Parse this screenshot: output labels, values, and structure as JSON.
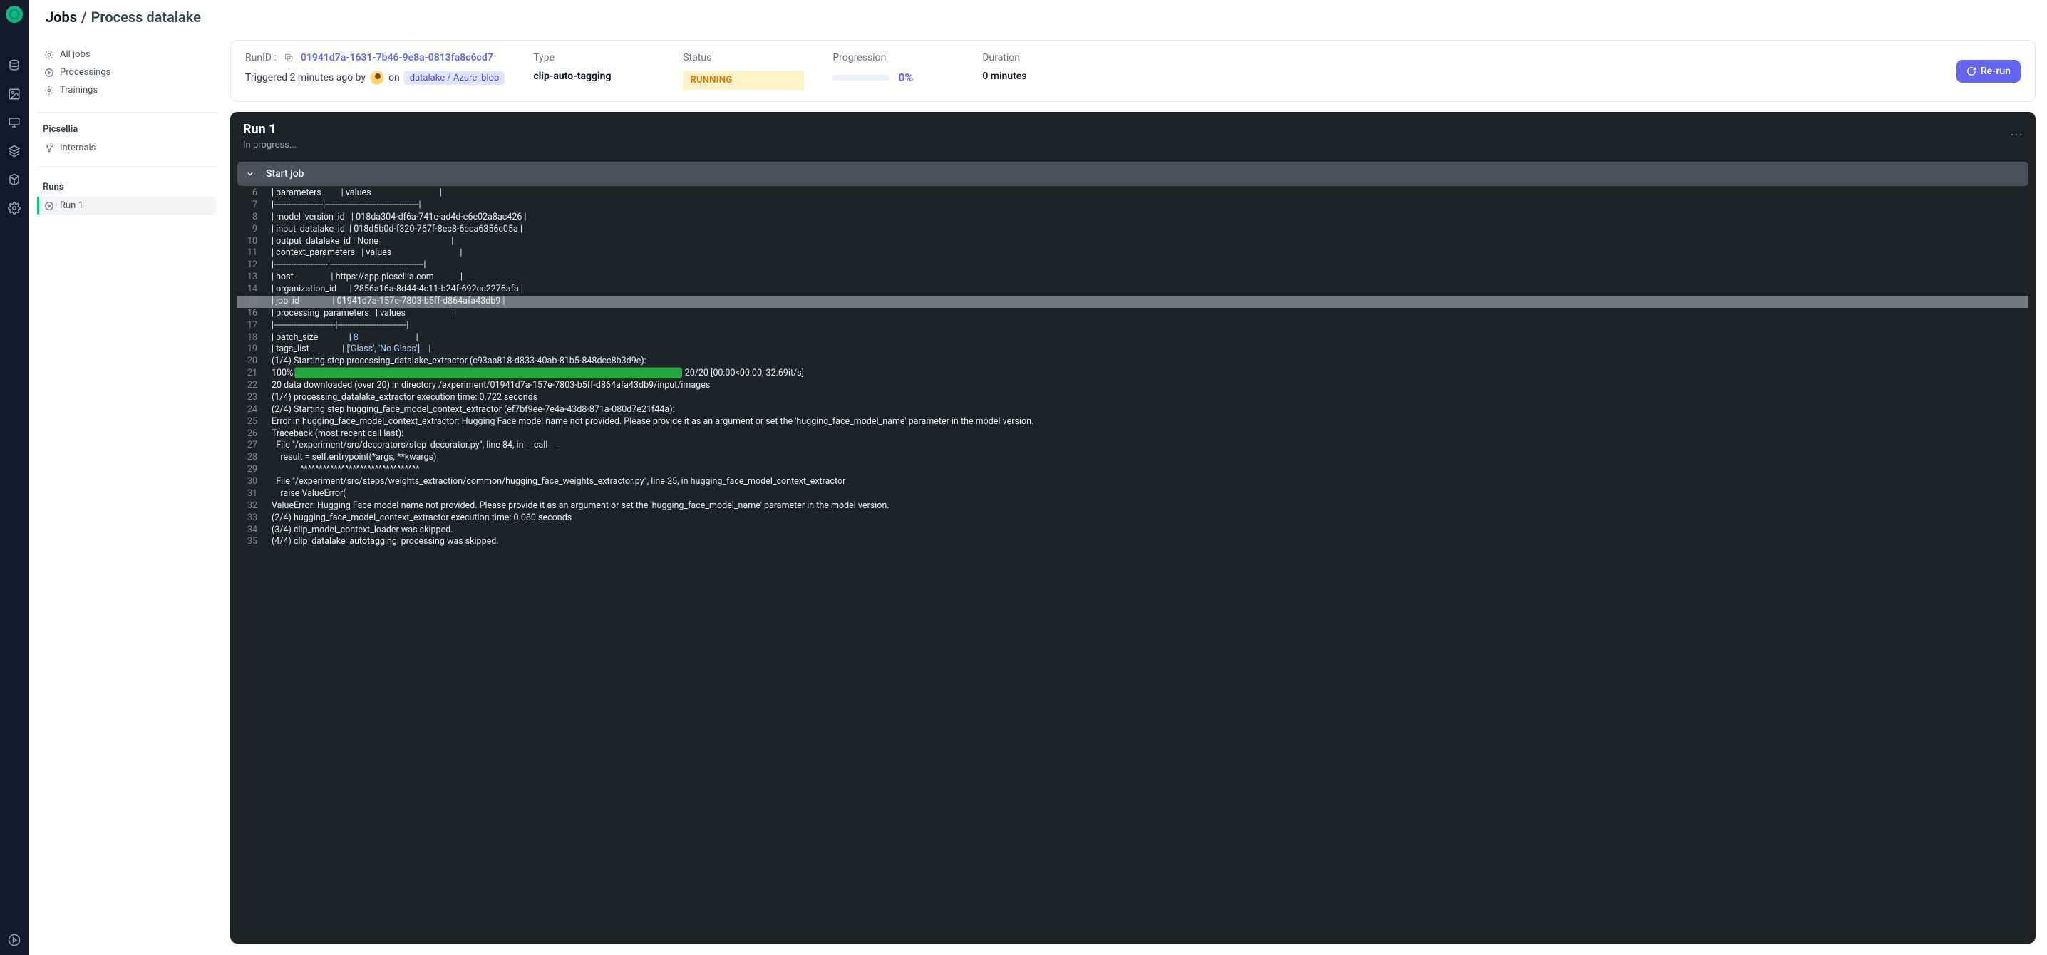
{
  "breadcrumb": {
    "root": "Jobs",
    "sep": "/",
    "page": "Process datalake"
  },
  "sidebar": {
    "groups": [
      {
        "items": [
          {
            "label": "All jobs"
          },
          {
            "label": "Processings"
          },
          {
            "label": "Trainings"
          }
        ]
      },
      {
        "title": "Picsellia",
        "items": [
          {
            "label": "Internals"
          }
        ]
      },
      {
        "title": "Runs",
        "items": [
          {
            "label": "Run 1",
            "active": true
          }
        ]
      }
    ]
  },
  "info": {
    "runid_label": "RunID :",
    "runid": "01941d7a-1631-7b46-9e8a-0813fa8c6cd7",
    "triggered_prefix": "Triggered 2 minutes ago by",
    "triggered_on": "on",
    "context": "datalake / Azure_blob",
    "type_label": "Type",
    "type_value": "clip-auto-tagging",
    "status_label": "Status",
    "status_value": "RUNNING",
    "progress_label": "Progression",
    "progress_value": "0%",
    "duration_label": "Duration",
    "duration_value": "0 minutes",
    "rerun": "Re-run"
  },
  "run": {
    "title": "Run 1",
    "subtitle": "In progress...",
    "section": "Start job"
  },
  "logs": [
    {
      "n": 6,
      "t": "| parameters         | values                               |"
    },
    {
      "n": 7,
      "t": "|--------------------|--------------------------------------|"
    },
    {
      "n": 8,
      "t": "| model_version_id   | 018da304-df6a-741e-ad4d-e6e02a8ac426 |"
    },
    {
      "n": 9,
      "t": "| input_datalake_id  | 018d5b0d-f320-767f-8ec8-6cca6356c05a |"
    },
    {
      "n": 10,
      "t": "| output_datalake_id | None                                 |"
    },
    {
      "n": 11,
      "t": "| context_parameters   | values                               |"
    },
    {
      "n": 12,
      "t": "|----------------------|--------------------------------------|"
    },
    {
      "n": 13,
      "t": "| host                 | https://app.picsellia.com            |"
    },
    {
      "n": 14,
      "t": "| organization_id      | 2856a16a-8d44-4c11-b24f-692cc2276afa |"
    },
    {
      "n": 15,
      "t": "| job_id               | 01941d7a-157e-7803-b5ff-d864afa43db9 |",
      "hl": true
    },
    {
      "n": 16,
      "t": "| processing_parameters   | values                     |"
    },
    {
      "n": 17,
      "t": "|-------------------------|----------------------------|"
    },
    {
      "n": 18,
      "t": "| batch_size              | <NUM>8</NUM>                          |"
    },
    {
      "n": 19,
      "t": "| tags_list               | <STR>['Glass', 'No Glass']</STR>    |"
    },
    {
      "n": 20,
      "t": "(1/4) Starting step processing_datalake_extractor (c93aa818-d833-40ab-81b5-848dcc8b3d9e):"
    },
    {
      "n": 21,
      "t": "100%|<BAR>█████████████████████████████████████████████████████████████</BAR>| 20/20 [00:00<00:00, 32.69it/s]"
    },
    {
      "n": 22,
      "t": "20 data downloaded (over 20) in directory /experiment/01941d7a-157e-7803-b5ff-d864afa43db9/input/images"
    },
    {
      "n": 23,
      "t": "(1/4) processing_datalake_extractor execution time: 0.722 seconds"
    },
    {
      "n": 24,
      "t": "(2/4) Starting step hugging_face_model_context_extractor (ef7bf9ee-7e4a-43d8-871a-080d7e21f44a):"
    },
    {
      "n": 25,
      "t": "Error in hugging_face_model_context_extractor: Hugging Face model name not provided. Please provide it as an argument or set the 'hugging_face_model_name' parameter in the model version."
    },
    {
      "n": 26,
      "t": "Traceback (most recent call last):"
    },
    {
      "n": 27,
      "t": "  File \"/experiment/src/decorators/step_decorator.py\", line 84, in __call__"
    },
    {
      "n": 28,
      "t": "    result = self.entrypoint(*args, **kwargs)"
    },
    {
      "n": 29,
      "t": "             ^^^^^^^^^^^^^^^^^^^^^^^^^^^^^^^^"
    },
    {
      "n": 30,
      "t": "  File \"/experiment/src/steps/weights_extraction/common/hugging_face_weights_extractor.py\", line 25, in hugging_face_model_context_extractor"
    },
    {
      "n": 31,
      "t": "    raise ValueError("
    },
    {
      "n": 32,
      "t": "ValueError: Hugging Face model name not provided. Please provide it as an argument or set the 'hugging_face_model_name' parameter in the model version."
    },
    {
      "n": 33,
      "t": "(2/4) hugging_face_model_context_extractor execution time: 0.080 seconds"
    },
    {
      "n": 34,
      "t": "(3/4) clip_model_context_loader was skipped."
    },
    {
      "n": 35,
      "t": "(4/4) clip_datalake_autotagging_processing was skipped."
    }
  ]
}
